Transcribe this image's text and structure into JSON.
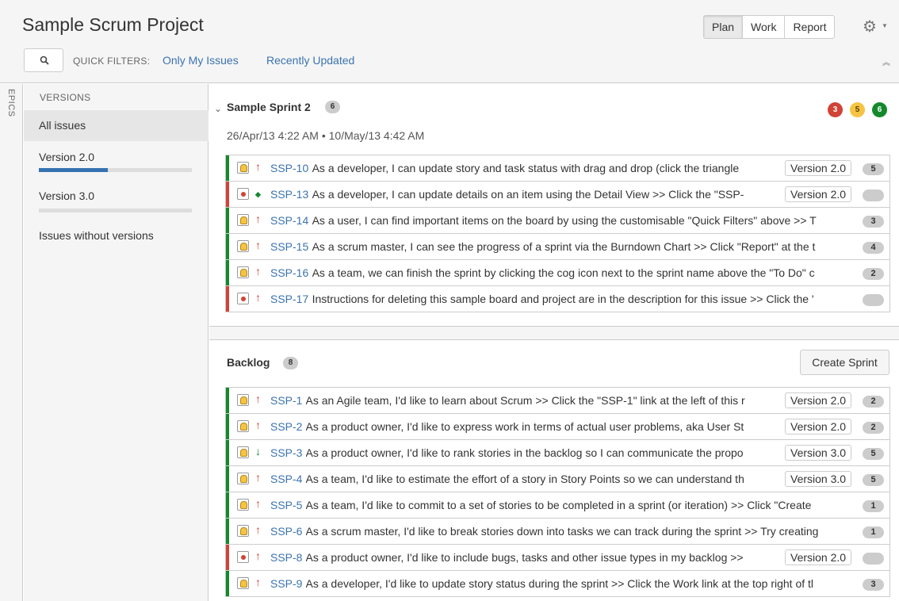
{
  "header": {
    "title": "Sample Scrum Project",
    "modes": [
      "Plan",
      "Work",
      "Report"
    ],
    "active_mode": "Plan"
  },
  "quick_filters": {
    "label": "QUICK FILTERS:",
    "filters": [
      "Only My Issues",
      "Recently Updated"
    ]
  },
  "sidebar": {
    "epics_label": "EPICS",
    "versions_heading": "VERSIONS",
    "items": [
      {
        "label": "All issues",
        "active": true
      },
      {
        "label": "Version 2.0",
        "progress": 0.45
      },
      {
        "label": "Version 3.0",
        "progress": 0
      },
      {
        "label": "Issues without versions"
      }
    ]
  },
  "sprint": {
    "name": "Sample Sprint 2",
    "count": "6",
    "dates": "26/Apr/13 4:22 AM • 10/May/13 4:42 AM",
    "status_counts": {
      "todo": "3",
      "in_progress": "5",
      "done": "6"
    },
    "issues": [
      {
        "type": "story",
        "priority": "major",
        "key": "SSP-10",
        "summary": "As a developer, I can update story and task status with drag and drop (click the triangle",
        "version": "Version 2.0",
        "estimate": "5"
      },
      {
        "type": "bug",
        "priority": "minor",
        "key": "SSP-13",
        "summary": "As a developer, I can update details on an item using the Detail View >> Click the \"SSP-",
        "version": "Version 2.0",
        "estimate": ""
      },
      {
        "type": "story",
        "priority": "major",
        "key": "SSP-14",
        "summary": "As a user, I can find important items on the board by using the customisable \"Quick Filters\" above >> T",
        "version": "",
        "estimate": "3"
      },
      {
        "type": "story",
        "priority": "major",
        "key": "SSP-15",
        "summary": "As a scrum master, I can see the progress of a sprint via the Burndown Chart >> Click \"Report\" at the t",
        "version": "",
        "estimate": "4"
      },
      {
        "type": "story",
        "priority": "major",
        "key": "SSP-16",
        "summary": "As a team, we can finish the sprint by clicking the cog icon next to the sprint name above the \"To Do\" c",
        "version": "",
        "estimate": "2"
      },
      {
        "type": "bug",
        "priority": "major",
        "key": "SSP-17",
        "summary": "Instructions for deleting this sample board and project are in the description for this issue >> Click the '",
        "version": "",
        "estimate": ""
      }
    ]
  },
  "backlog": {
    "name": "Backlog",
    "count": "8",
    "create_sprint_label": "Create Sprint",
    "issues": [
      {
        "type": "story",
        "priority": "major",
        "key": "SSP-1",
        "summary": "As an Agile team, I'd like to learn about Scrum >> Click the \"SSP-1\" link at the left of this r",
        "version": "Version 2.0",
        "estimate": "2"
      },
      {
        "type": "story",
        "priority": "major",
        "key": "SSP-2",
        "summary": "As a product owner, I'd like to express work in terms of actual user problems, aka User St",
        "version": "Version 2.0",
        "estimate": "2"
      },
      {
        "type": "story",
        "priority": "trivial",
        "key": "SSP-3",
        "summary": "As a product owner, I'd like to rank stories in the backlog so I can communicate the propo",
        "version": "Version 3.0",
        "estimate": "5"
      },
      {
        "type": "story",
        "priority": "major",
        "key": "SSP-4",
        "summary": "As a team, I'd like to estimate the effort of a story in Story Points so we can understand th",
        "version": "Version 3.0",
        "estimate": "5"
      },
      {
        "type": "story",
        "priority": "major",
        "key": "SSP-5",
        "summary": "As a team, I'd like to commit to a set of stories to be completed in a sprint (or iteration) >> Click \"Create",
        "version": "",
        "estimate": "1"
      },
      {
        "type": "story",
        "priority": "major",
        "key": "SSP-6",
        "summary": "As a scrum master, I'd like to break stories down into tasks we can track during the sprint >> Try creating",
        "version": "",
        "estimate": "1"
      },
      {
        "type": "bug",
        "priority": "major",
        "key": "SSP-8",
        "summary": "As a product owner, I'd like to include bugs, tasks and other issue types in my backlog >>",
        "version": "Version 2.0",
        "estimate": ""
      },
      {
        "type": "story",
        "priority": "major",
        "key": "SSP-9",
        "summary": "As a developer, I'd like to update story status during the sprint >> Click the Work link at the top right of tl",
        "version": "",
        "estimate": "3"
      }
    ]
  },
  "colors": {
    "accent": "#3b73af",
    "story": "#14892c",
    "bug": "#d04437",
    "todo": "#d04437",
    "in_progress": "#f6c342",
    "done": "#14892c"
  }
}
